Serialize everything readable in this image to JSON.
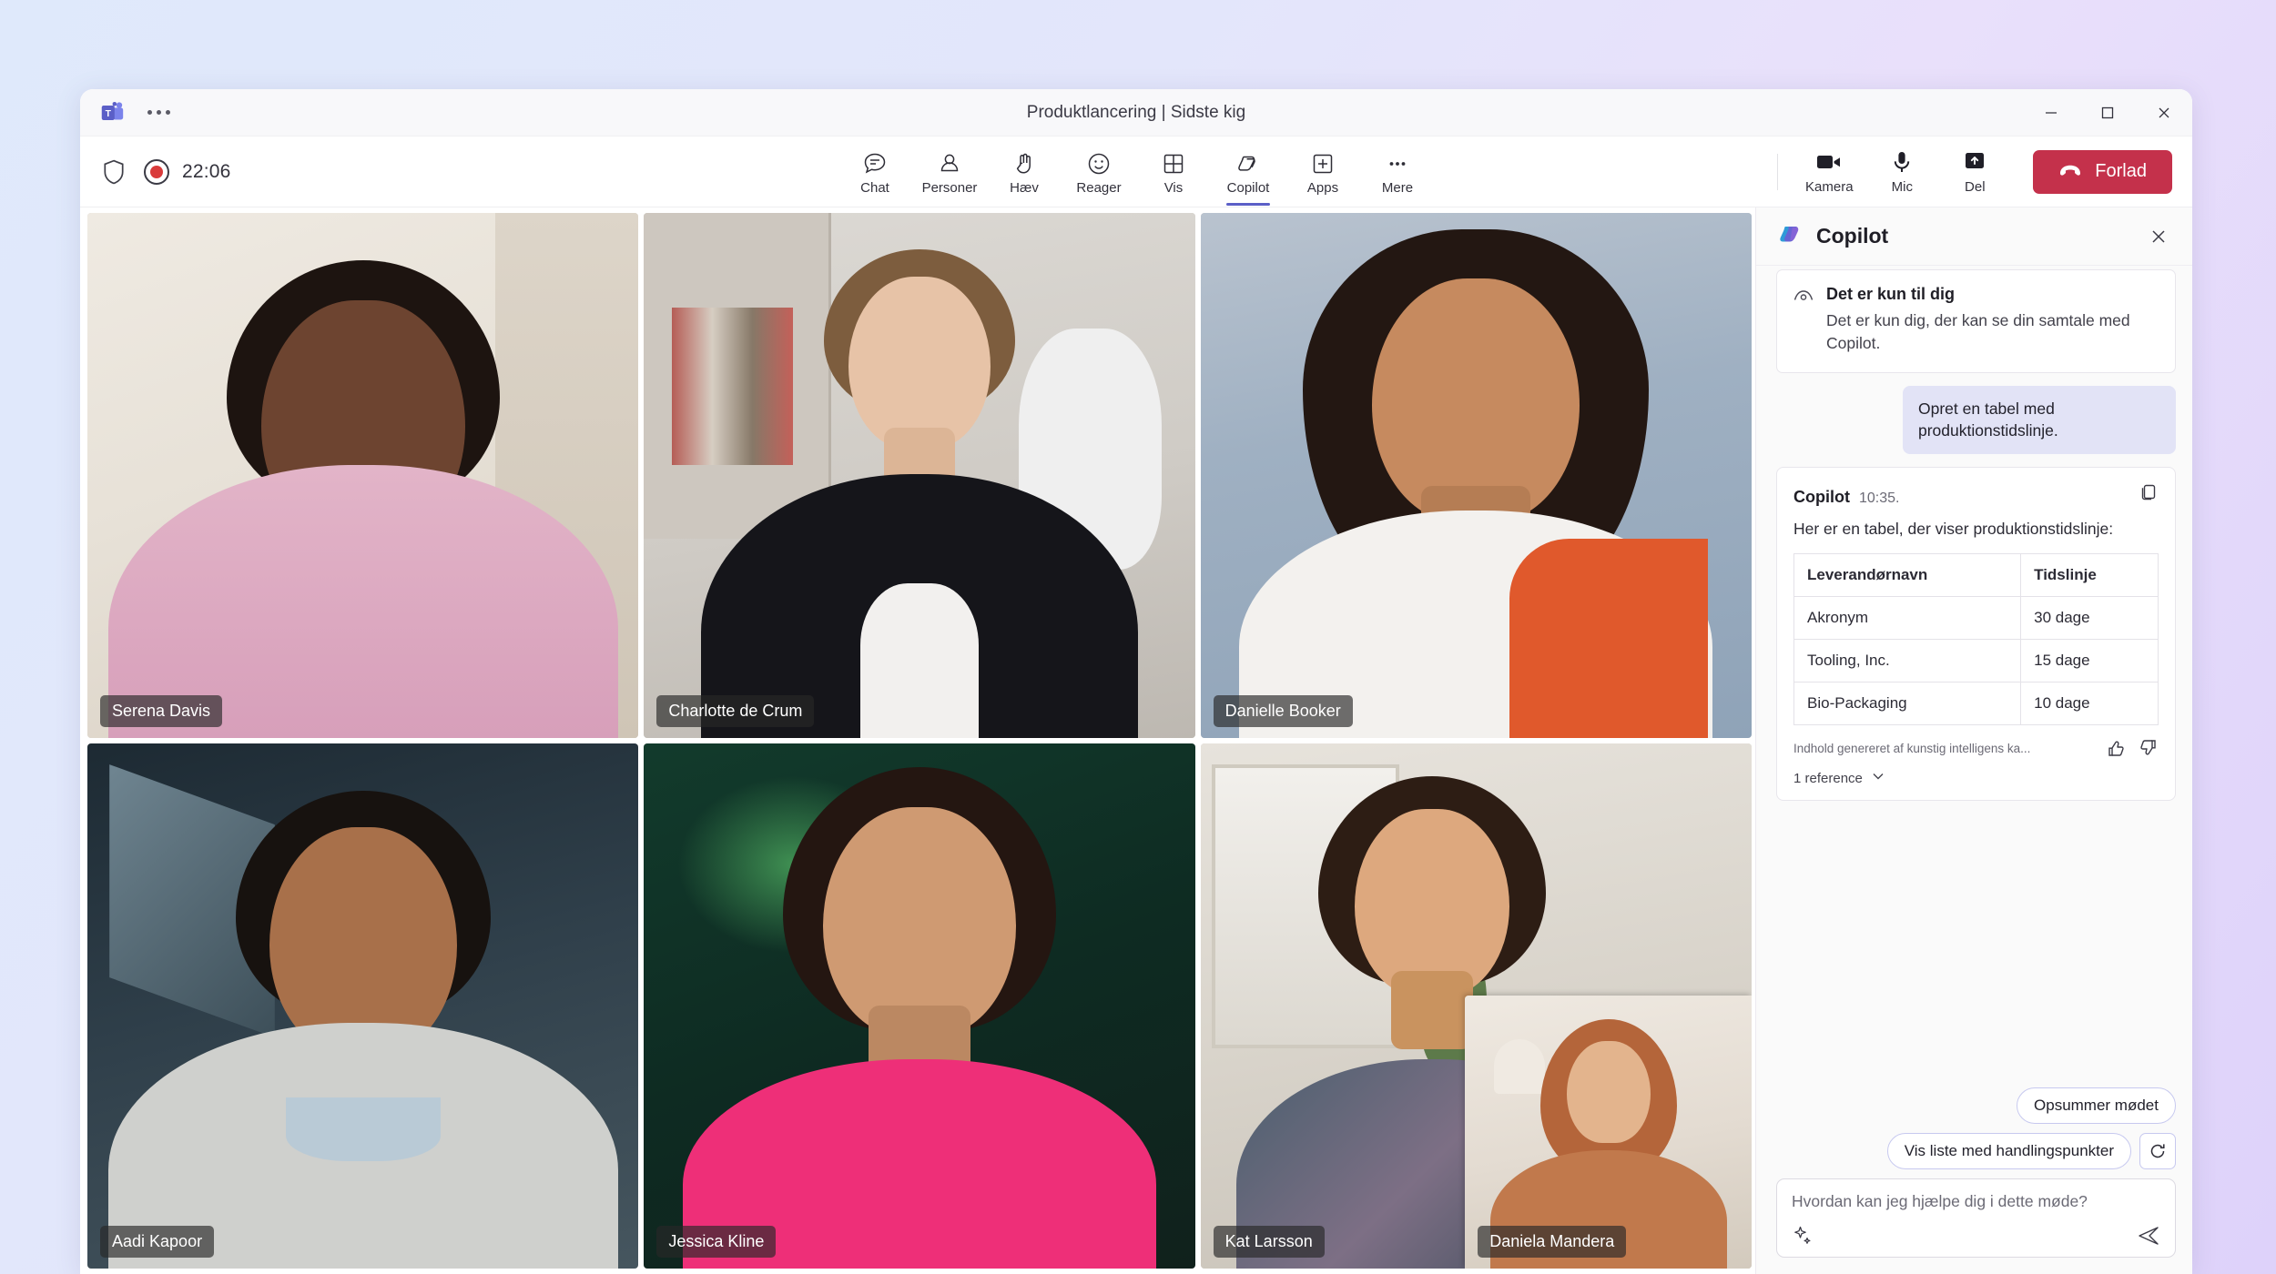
{
  "window": {
    "title": "Produktlancering | Sidste kig",
    "app_icon": "teams-logo",
    "overflow_icon": "more-options-icon",
    "controls": {
      "minimize": "minimize-icon",
      "maximize": "maximize-icon",
      "close": "close-icon"
    }
  },
  "call_status": {
    "shield_icon": "shield-icon",
    "recording_icon": "recording-indicator",
    "timer": "22:06"
  },
  "toolbar": {
    "items": [
      {
        "label": "Chat",
        "icon": "chat-icon",
        "active": false
      },
      {
        "label": "Personer",
        "icon": "people-icon",
        "active": false
      },
      {
        "label": "Hæv",
        "icon": "raise-hand-icon",
        "active": false
      },
      {
        "label": "Reager",
        "icon": "react-emoji-icon",
        "active": false
      },
      {
        "label": "Vis",
        "icon": "view-grid-icon",
        "active": false
      },
      {
        "label": "Copilot",
        "icon": "copilot-icon",
        "active": true
      },
      {
        "label": "Apps",
        "icon": "apps-plus-icon",
        "active": false
      },
      {
        "label": "Mere",
        "icon": "more-ellipsis-icon",
        "active": false
      }
    ],
    "devices": [
      {
        "label": "Kamera",
        "icon": "camera-icon"
      },
      {
        "label": "Mic",
        "icon": "microphone-icon"
      },
      {
        "label": "Del",
        "icon": "share-screen-icon"
      }
    ],
    "leave": {
      "label": "Forlad",
      "icon": "hangup-icon",
      "color": "#c4314b"
    }
  },
  "participants": [
    {
      "name": "Serena Davis"
    },
    {
      "name": "Charlotte de Crum"
    },
    {
      "name": "Danielle Booker"
    },
    {
      "name": "Aadi Kapoor"
    },
    {
      "name": "Jessica Kline"
    },
    {
      "name": "Kat Larsson"
    }
  ],
  "pip_participant": {
    "name": "Daniela Mandera"
  },
  "copilot": {
    "title": "Copilot",
    "logo_icon": "copilot-logo-icon",
    "close_icon": "close-icon",
    "notice": {
      "icon": "eye-privacy-icon",
      "heading": "Det er kun til dig",
      "body": "Det er kun dig, der kan se din samtale med Copilot."
    },
    "user_message": "Opret en tabel med produktionstidslinje.",
    "response": {
      "author": "Copilot",
      "time": "10:35.",
      "copy_icon": "copy-icon",
      "text": "Her er en tabel, der viser produktionstidslinje:",
      "table": {
        "headers": [
          "Leverandørnavn",
          "Tidslinje"
        ],
        "rows": [
          [
            "Akronym",
            "30 dage"
          ],
          [
            "Tooling, Inc.",
            "15 dage"
          ],
          [
            "Bio-Packaging",
            "10 dage"
          ]
        ]
      },
      "ai_disclaimer": "Indhold genereret af kunstig intelligens ka...",
      "thumbs_up_icon": "thumbs-up-icon",
      "thumbs_down_icon": "thumbs-down-icon",
      "reference_label": "1 reference",
      "reference_chevron": "chevron-down-icon"
    },
    "suggestions": [
      {
        "label": "Opsummer mødet"
      },
      {
        "label": "Vis liste med handlingspunkter"
      }
    ],
    "refresh_icon": "refresh-icon",
    "composer": {
      "placeholder": "Hvordan kan jeg hjælpe dig i dette møde?",
      "sparkle_icon": "sparkle-icon",
      "send_icon": "send-icon"
    }
  },
  "theme": {
    "accent": "#5b5fc7",
    "leave_red": "#c4314b",
    "user_bubble": "#e2e3f6"
  }
}
